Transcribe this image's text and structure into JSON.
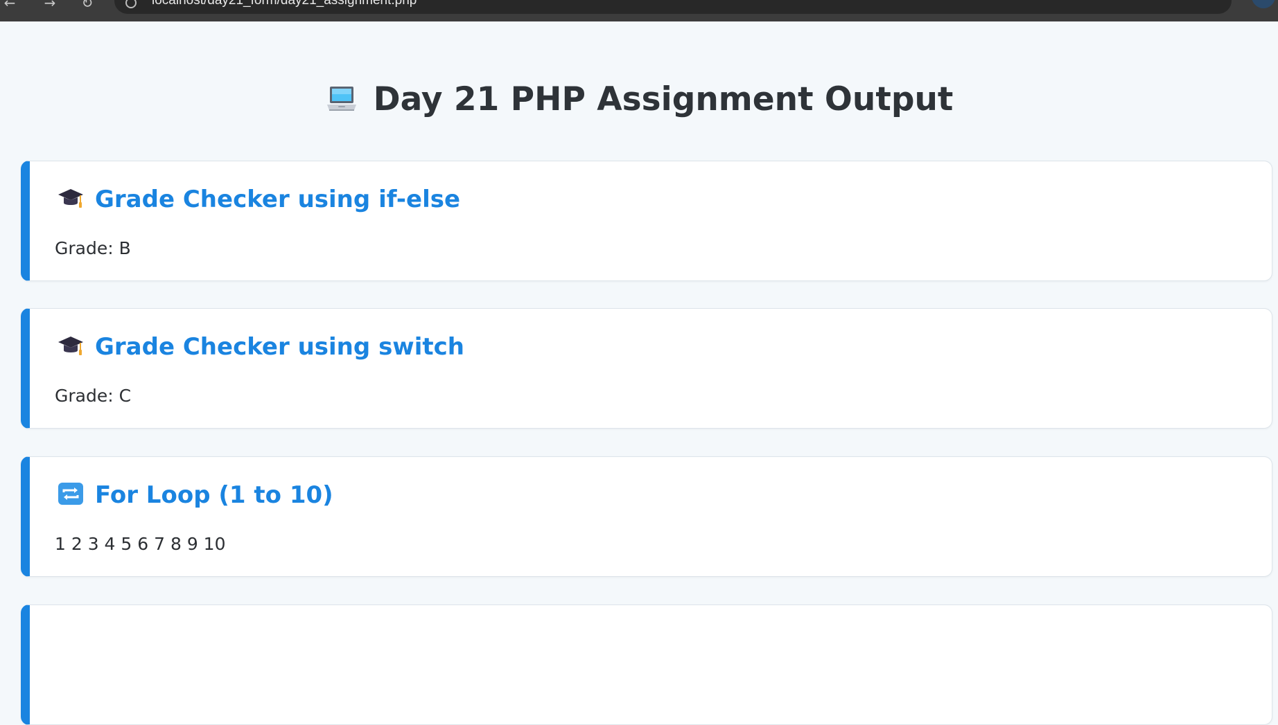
{
  "browser": {
    "url": "localhost/day21_form/day21_assignment.php"
  },
  "page": {
    "title": "Day 21 PHP Assignment Output",
    "title_icon": "laptop-emoji"
  },
  "sections": [
    {
      "icon": "graduation-cap-emoji",
      "heading": "Grade Checker using if-else",
      "output": "Grade: B"
    },
    {
      "icon": "graduation-cap-emoji",
      "heading": "Grade Checker using switch",
      "output": "Grade: C"
    },
    {
      "icon": "repeat-arrows-emoji",
      "heading": "For Loop (1 to 10)",
      "output": "1 2 3 4 5 6 7 8 9 10"
    }
  ],
  "colors": {
    "accent": "#1a84e0",
    "page_background": "#f4f8fb",
    "card_background": "#ffffff",
    "title_text": "#2e3338",
    "body_text": "#2c2f33"
  }
}
